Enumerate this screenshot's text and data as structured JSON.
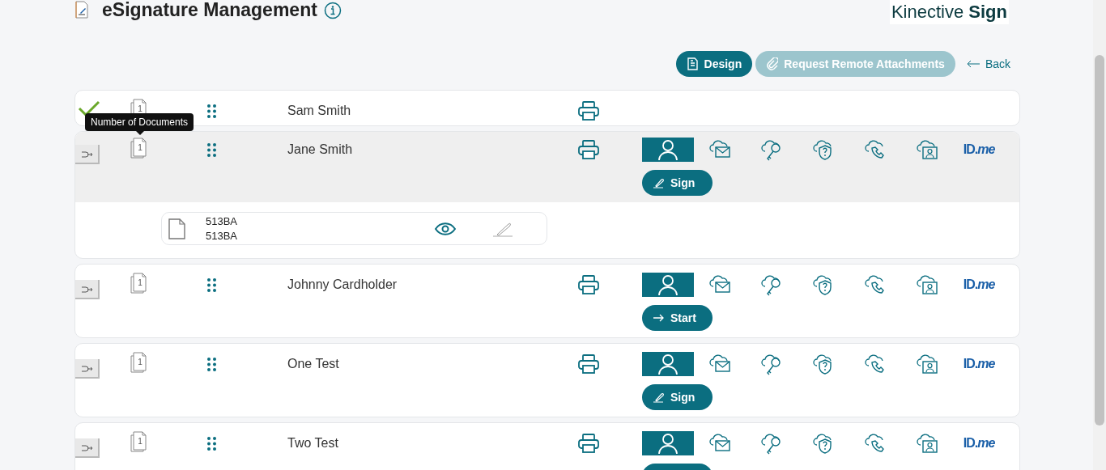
{
  "header": {
    "title": "eSignature Management",
    "logo": "Kinective **Sign**"
  },
  "toolbar": {
    "buttons": [
      {
        "kind": "design",
        "label": "Design",
        "disabled": false
      },
      {
        "kind": "attach",
        "label": "Request Remote Attachments",
        "disabled": true
      }
    ],
    "back": "Back"
  },
  "tooltip": "Number of Documents",
  "signers": [
    {
      "name": "Sam Smith",
      "completed": true,
      "expanded": false,
      "doc_count": "1"
    },
    {
      "name": "Jane Smith",
      "completed": false,
      "expanded": true,
      "doc_count": "1",
      "auth_methods": [
        {
          "kind": "in-person",
          "selected": true
        },
        {
          "kind": "email",
          "selected": false
        },
        {
          "kind": "key",
          "selected": false
        },
        {
          "kind": "question",
          "selected": false
        },
        {
          "kind": "phone",
          "selected": false
        },
        {
          "kind": "video",
          "selected": false
        },
        {
          "kind": "idme",
          "label": "ID.*me*",
          "selected": false
        }
      ],
      "action": {
        "kind": "sign",
        "label": "Sign"
      },
      "documents": [
        {
          "lines": [
            "513BA",
            "513BA"
          ]
        }
      ]
    },
    {
      "name": "Johnny Cardholder",
      "completed": false,
      "expanded": false,
      "doc_count": "1",
      "auth_methods": [
        {
          "kind": "in-person",
          "selected": true
        },
        {
          "kind": "email",
          "selected": false
        },
        {
          "kind": "key",
          "selected": false
        },
        {
          "kind": "question",
          "selected": false
        },
        {
          "kind": "phone",
          "selected": false
        },
        {
          "kind": "video",
          "selected": false
        },
        {
          "kind": "idme",
          "label": "ID.*me*",
          "selected": false
        }
      ],
      "action": {
        "kind": "start",
        "label": "Start"
      }
    },
    {
      "name": "One Test",
      "completed": false,
      "expanded": false,
      "doc_count": "1",
      "auth_methods": [
        {
          "kind": "in-person",
          "selected": true
        },
        {
          "kind": "email",
          "selected": false
        },
        {
          "kind": "key",
          "selected": false
        },
        {
          "kind": "question",
          "selected": false
        },
        {
          "kind": "phone",
          "selected": false
        },
        {
          "kind": "video",
          "selected": false
        },
        {
          "kind": "idme",
          "label": "ID.*me*",
          "selected": false
        }
      ],
      "action": {
        "kind": "sign",
        "label": "Sign"
      }
    },
    {
      "name": "Two Test",
      "completed": false,
      "expanded": false,
      "doc_count": "1",
      "auth_methods": [
        {
          "kind": "in-person",
          "selected": true
        },
        {
          "kind": "email",
          "selected": false
        },
        {
          "kind": "key",
          "selected": false
        },
        {
          "kind": "question",
          "selected": false
        },
        {
          "kind": "phone",
          "selected": false
        },
        {
          "kind": "video",
          "selected": false
        },
        {
          "kind": "idme",
          "label": "ID.*me*",
          "selected": false
        }
      ],
      "action": {
        "kind": "cut"
      }
    }
  ]
}
